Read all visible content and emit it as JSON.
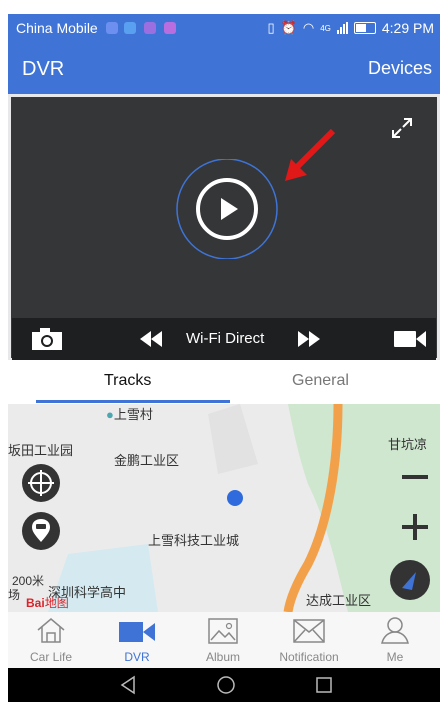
{
  "status_bar": {
    "carrier": "China Mobile",
    "network": "4G",
    "time": "4:29 PM"
  },
  "app_bar": {
    "title": "DVR",
    "devices_label": "Devices"
  },
  "video": {
    "mode_label": "Wi-Fi Direct"
  },
  "tabs": [
    {
      "label": "Tracks",
      "active": true
    },
    {
      "label": "General",
      "active": false
    }
  ],
  "map": {
    "labels": [
      "上雪村",
      "坂田工业园",
      "金鹏工业区",
      "甘坑凉",
      "上雪科技工业城",
      "深圳科学高中",
      "达成工业区"
    ],
    "scale": "200米",
    "scale_suffix": "场",
    "brand": "Bai",
    "brand_suffix": "地图"
  },
  "nav": [
    {
      "label": "Car Life",
      "icon": "home-icon"
    },
    {
      "label": "DVR",
      "icon": "camera-icon",
      "active": true
    },
    {
      "label": "Album",
      "icon": "picture-icon"
    },
    {
      "label": "Notification",
      "icon": "mail-icon"
    },
    {
      "label": "Me",
      "icon": "person-icon"
    }
  ],
  "colors": {
    "primary": "#3f74d6",
    "video_bg": "#343638",
    "controls_bg": "#1e1f21",
    "road": "#f2a14a",
    "green": "#cfe6cf",
    "arrow": "#e01818"
  }
}
